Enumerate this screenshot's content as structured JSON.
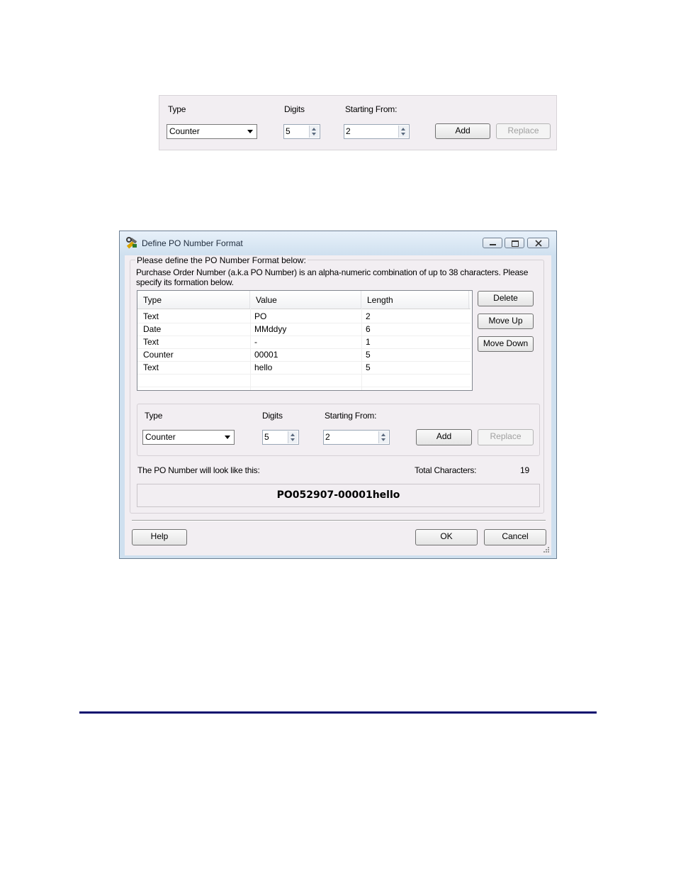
{
  "snippet": {
    "type_label": "Type",
    "digits_label": "Digits",
    "starting_label": "Starting From:",
    "type_value": "Counter",
    "digits_value": "5",
    "starting_value": "2",
    "add_label": "Add",
    "replace_label": "Replace"
  },
  "dialog": {
    "title": "Define PO Number Format",
    "group_legend": "Please define the PO Number Format below:",
    "description": "Purchase Order Number (a.k.a PO Number) is an alpha-numeric combination of up to 38 characters. Please specify its formation below.",
    "columns": [
      "Type",
      "Value",
      "Length"
    ],
    "rows": [
      {
        "type": "Text",
        "value": "PO",
        "length": "2"
      },
      {
        "type": "Date",
        "value": "MMddyy",
        "length": "6"
      },
      {
        "type": "Text",
        "value": "-",
        "length": "1"
      },
      {
        "type": "Counter",
        "value": "00001",
        "length": "5"
      },
      {
        "type": "Text",
        "value": "hello",
        "length": "5"
      }
    ],
    "side_buttons": {
      "delete": "Delete",
      "move_up": "Move Up",
      "move_down": "Move Down"
    },
    "editor": {
      "type_label": "Type",
      "digits_label": "Digits",
      "starting_label": "Starting From:",
      "type_value": "Counter",
      "digits_value": "5",
      "starting_value": "2",
      "add_label": "Add",
      "replace_label": "Replace"
    },
    "preview_label": "The PO Number will look like this:",
    "total_label": "Total Characters:",
    "total_value": "19",
    "preview_value": "PO052907-00001hello",
    "help_label": "Help",
    "ok_label": "OK",
    "cancel_label": "Cancel"
  },
  "colors": {
    "dialog_frame": "#cfe0ef",
    "panel_bg": "#f2eef2",
    "rule": "#0b0d6e"
  }
}
